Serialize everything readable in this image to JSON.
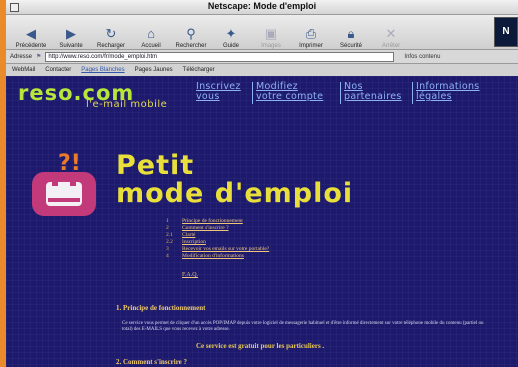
{
  "window": {
    "title": "Netscape: Mode d'emploi"
  },
  "toolbar": {
    "buttons": [
      {
        "label": "Précédente",
        "icon": "back-arrow-icon"
      },
      {
        "label": "Suivante",
        "icon": "forward-arrow-icon"
      },
      {
        "label": "Recharger",
        "icon": "reload-icon"
      },
      {
        "label": "Accueil",
        "icon": "home-icon"
      },
      {
        "label": "Rechercher",
        "icon": "search-icon"
      },
      {
        "label": "Guide",
        "icon": "guide-icon"
      },
      {
        "label": "Images",
        "icon": "images-icon"
      },
      {
        "label": "Imprimer",
        "icon": "print-icon"
      },
      {
        "label": "Sécurité",
        "icon": "security-icon"
      },
      {
        "label": "Arrêter",
        "icon": "stop-icon"
      }
    ],
    "brand": "N"
  },
  "address": {
    "label": "Adresse",
    "value": "http://www.reso.com/fr/mode_emploi.htm",
    "info_label": "Infos contenu"
  },
  "personal_bar": {
    "items": [
      "WebMail",
      "Contacter",
      "Pages Blanches",
      "Pages Jaunes",
      "Télécharger"
    ]
  },
  "site": {
    "logo": "reso.com",
    "logo_sub": "l'e-mail mobile",
    "nav": [
      {
        "line1": "Inscrivez",
        "line2": "vous"
      },
      {
        "line1": "Modifiez",
        "line2": "votre compte"
      },
      {
        "line1": "Nos",
        "line2": "partenaires"
      },
      {
        "line1": "Informations",
        "line2": "légales"
      }
    ],
    "headline_line1": "Petit",
    "headline_line2": "mode d'emploi",
    "toc": [
      {
        "num": "1",
        "label": "Principe de fonctionnement"
      },
      {
        "num": "2",
        "label": "Comment s'inscrire ?"
      },
      {
        "num": "2.1",
        "label": "Clarté"
      },
      {
        "num": "2.2",
        "label": "Inscription"
      },
      {
        "num": "3",
        "label": "Recevoir vos emails sur votre portable?"
      },
      {
        "num": "4",
        "label": "Modification d'informations"
      }
    ],
    "faq": "F.A.Q.",
    "section1_title": "1.  Principe de fonctionnement",
    "section1_text": "Ce service vous permet de cliquer d'un accès POP/IMAP depuis votre logiciel de messagerie habituel et d'être informé directement sur votre téléphone mobile du contenu (partiel ou total) des E-MAILS que vous recevez à votre adresse.",
    "section1_highlight": "Ce service est gratuit pour les particuliers .",
    "section2_title": "2.  Comment s'inscrire ?"
  }
}
